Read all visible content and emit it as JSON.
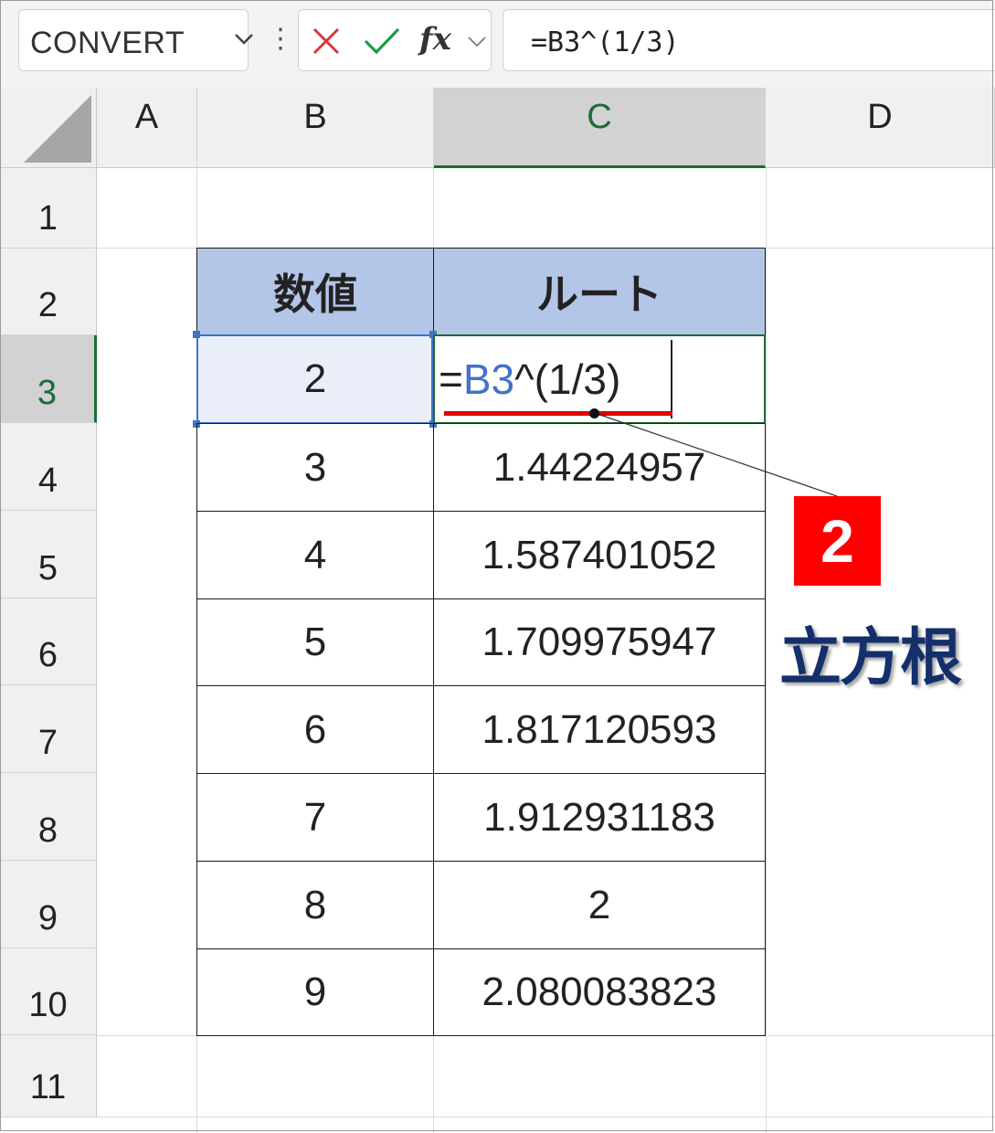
{
  "formula_bar": {
    "name_box": "CONVERT",
    "fx_label": "fx",
    "formula": "=B3^(1/3)",
    "cancel_icon": "x-icon",
    "enter_icon": "check-icon"
  },
  "columns": [
    "A",
    "B",
    "C",
    "D"
  ],
  "rows": [
    "1",
    "2",
    "3",
    "4",
    "5",
    "6",
    "7",
    "8",
    "9",
    "10",
    "11"
  ],
  "table": {
    "headers": [
      "数値",
      "ルート"
    ],
    "edit_cell": {
      "prefix": "=",
      "ref": "B3",
      "suffix": "^(1/3)"
    },
    "b3_value": "2",
    "rows": [
      {
        "num": "3",
        "root": "1.44224957"
      },
      {
        "num": "4",
        "root": "1.587401052"
      },
      {
        "num": "5",
        "root": "1.709975947"
      },
      {
        "num": "6",
        "root": "1.817120593"
      },
      {
        "num": "7",
        "root": "1.912931183"
      },
      {
        "num": "8",
        "root": "2"
      },
      {
        "num": "9",
        "root": "2.080083823"
      }
    ]
  },
  "annotation": {
    "badge": "2",
    "label": "立方根",
    "underline_color": "#e00000",
    "badge_color": "#ff0000",
    "label_color": "#13306b"
  },
  "colors": {
    "select_green": "#1d6b37",
    "select_blue": "#4472c4",
    "header_fill": "#b4c6e7"
  }
}
